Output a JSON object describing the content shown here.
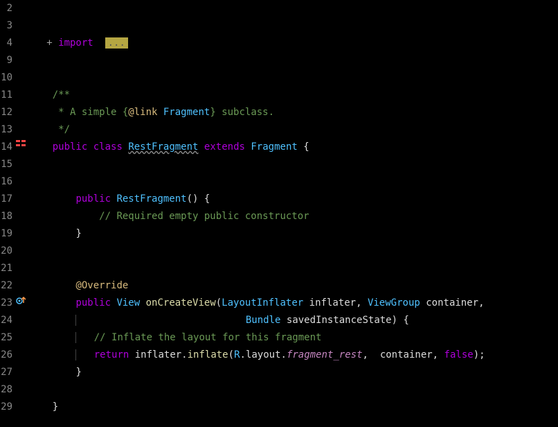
{
  "gutter": {
    "l2": "2",
    "l3": "3",
    "l4": "4",
    "l9": "9",
    "l10": "10",
    "l11": "11",
    "l12": "12",
    "l13": "13",
    "l14": "14",
    "l15": "15",
    "l16": "16",
    "l17": "17",
    "l18": "18",
    "l19": "19",
    "l20": "20",
    "l21": "21",
    "l22": "22",
    "l23": "23",
    "l24": "24",
    "l25": "25",
    "l26": "26",
    "l27": "27",
    "l28": "28",
    "l29": "29"
  },
  "code": {
    "import_plus": "   +",
    "import_kw": " import ",
    "import_ellipsis": "...",
    "doc_start": "    /**",
    "doc_l1a": "     * A simple {",
    "doc_l1b": "@link",
    "doc_l1c": " Fragment",
    "doc_l1d": "} subclass.",
    "doc_end": "     */",
    "cls_public": "public",
    "cls_sp": " ",
    "cls_class": "class",
    "cls_name": "RestFragment",
    "cls_extends": "extends",
    "cls_super": "Fragment",
    "cls_open": " {",
    "ctor_public": "public",
    "ctor_name": "RestFragment",
    "ctor_paren": "()",
    "ctor_open": " {",
    "ctor_cmt": "// Required empty public constructor",
    "ctor_close": "}",
    "override": "@Override",
    "ocv_public": "public",
    "ocv_view": "View",
    "ocv_name": "onCreateView",
    "ocv_paren_o": "(",
    "ocv_t1": "LayoutInflater",
    "ocv_p1": " inflater",
    "ocv_comma": ", ",
    "ocv_t2": "ViewGroup",
    "ocv_p2": " container",
    "ocv_comma2": ",",
    "ocv_t3": "Bundle",
    "ocv_p3": " savedInstanceState",
    "ocv_paren_c": ")",
    "ocv_open": " {",
    "inflate_cmt": "// Inflate the layout for this fragment",
    "ret_kw": "return",
    "ret_obj": " inflater.",
    "ret_call": "inflate",
    "ret_paren_o": "(",
    "ret_r": "R",
    "ret_dot1": ".",
    "ret_layout": "layout",
    "ret_dot2": ".",
    "ret_frag": "fragment_rest",
    "ret_comma1": ",  container, ",
    "ret_false": "false",
    "ret_end": ");",
    "ocv_close": "}",
    "cls_close": "}",
    "pad4": "    ",
    "pad8": "        ",
    "pad12": "            ",
    "pad_param": "                             "
  }
}
